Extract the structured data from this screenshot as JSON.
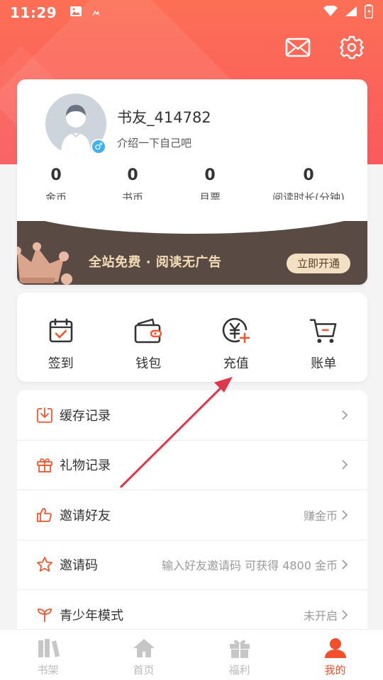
{
  "status_bar": {
    "time": "11:29"
  },
  "header": {
    "mail_icon": "mail-icon",
    "settings_icon": "gear-icon"
  },
  "profile": {
    "username": "书友_414782",
    "bio": "介绍一下自己吧",
    "gender_symbol": "♂",
    "stats": [
      {
        "value": "0",
        "label": "金币"
      },
      {
        "value": "0",
        "label": "书币"
      },
      {
        "value": "0",
        "label": "月票"
      },
      {
        "value": "0",
        "label": "阅读时长(分钟)"
      }
    ]
  },
  "vip": {
    "text": "全站免费 · 阅读无广告",
    "button": "立即开通"
  },
  "quick_actions": [
    {
      "label": "签到",
      "icon": "calendar-check-icon"
    },
    {
      "label": "钱包",
      "icon": "wallet-icon"
    },
    {
      "label": "充值",
      "icon": "yen-coin-icon"
    },
    {
      "label": "账单",
      "icon": "cart-icon"
    }
  ],
  "menu": [
    {
      "label": "缓存记录",
      "right": "",
      "icon": "download-icon"
    },
    {
      "label": "礼物记录",
      "right": "",
      "icon": "gift-icon"
    },
    {
      "label": "邀请好友",
      "right": "赚金币",
      "icon": "thumbs-up-icon"
    },
    {
      "label": "邀请码",
      "right": "输入好友邀请码 可获得 4800 金币",
      "icon": "star-icon"
    },
    {
      "label": "青少年模式",
      "right": "未开启",
      "icon": "sprout-icon"
    }
  ],
  "bottom_nav": [
    {
      "label": "书架",
      "icon": "bookshelf-icon",
      "active": false
    },
    {
      "label": "首页",
      "icon": "home-icon",
      "active": false
    },
    {
      "label": "福利",
      "icon": "gift-icon",
      "active": false
    },
    {
      "label": "我的",
      "icon": "user-icon",
      "active": true
    }
  ],
  "colors": {
    "brand": "#f95a5e",
    "accent": "#f44f2a",
    "vip_bg": "#5a4a44",
    "vip_text": "#f2ddb7"
  }
}
